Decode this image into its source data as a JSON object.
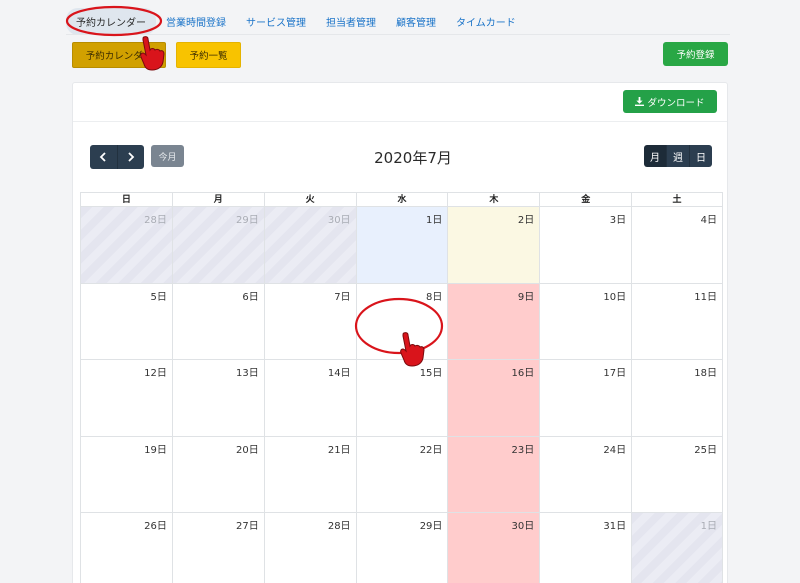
{
  "nav": {
    "items": [
      {
        "label": "予約カレンダー",
        "active": true
      },
      {
        "label": "営業時間登録"
      },
      {
        "label": "サービス管理"
      },
      {
        "label": "担当者管理"
      },
      {
        "label": "顧客管理"
      },
      {
        "label": "タイムカード"
      }
    ]
  },
  "subnav": {
    "calendar_label": "予約カレンダー",
    "list_label": "予約一覧"
  },
  "register_label": "予約登録",
  "download_label": "ダウンロード",
  "calendar": {
    "today_label": "今月",
    "title": "2020年7月",
    "views": [
      "月",
      "週",
      "日"
    ],
    "weekdays": [
      "日",
      "月",
      "火",
      "水",
      "木",
      "金",
      "土"
    ],
    "weeks": [
      [
        "28日",
        "29日",
        "30日",
        "1日",
        "2日",
        "3日",
        "4日"
      ],
      [
        "5日",
        "6日",
        "7日",
        "8日",
        "9日",
        "10日",
        "11日"
      ],
      [
        "12日",
        "13日",
        "14日",
        "15日",
        "16日",
        "17日",
        "18日"
      ],
      [
        "19日",
        "20日",
        "21日",
        "22日",
        "23日",
        "24日",
        "25日"
      ],
      [
        "26日",
        "27日",
        "28日",
        "29日",
        "30日",
        "31日",
        "1日"
      ]
    ]
  },
  "colors": {
    "accent_green": "#29a745",
    "tab_gold": "#d1a000",
    "tab_yellow": "#f8c300",
    "closed_day": "#ffcccc",
    "today_cell": "#e8f0fd",
    "annotation_red": "#d9141b"
  },
  "icons": {
    "prev": "chevron-left-icon",
    "next": "chevron-right-icon",
    "download": "download-icon",
    "pointer": "pointing-hand-icon"
  }
}
